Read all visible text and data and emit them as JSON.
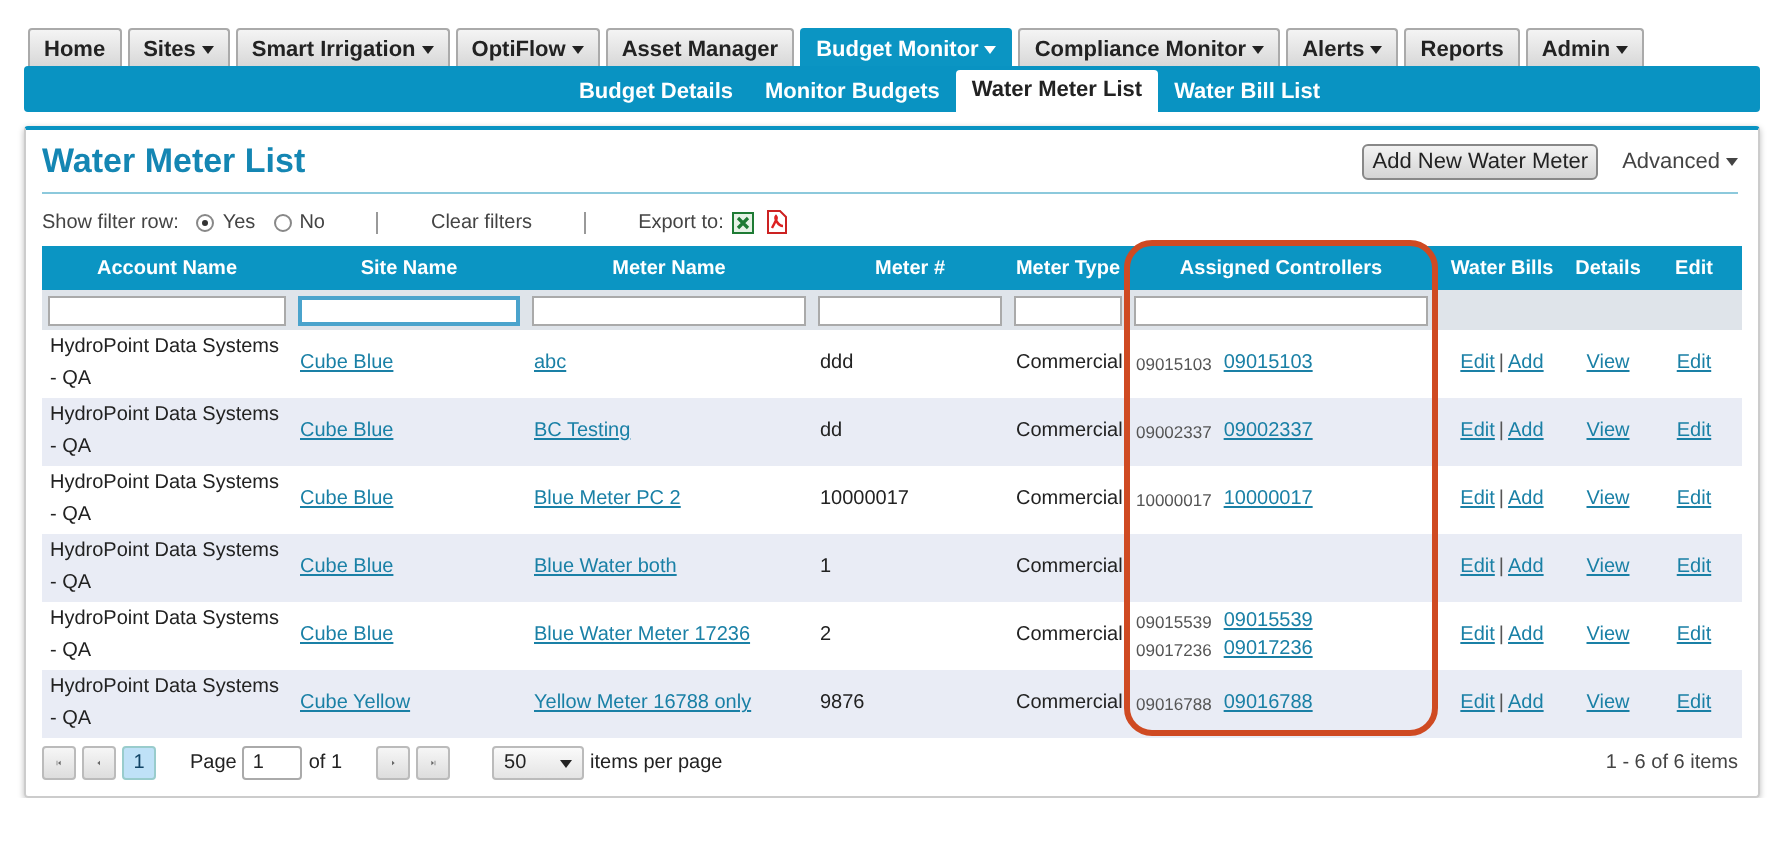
{
  "nav_tabs": [
    {
      "label": "Home",
      "dropdown": false,
      "selected": false
    },
    {
      "label": "Sites",
      "dropdown": true,
      "selected": false
    },
    {
      "label": "Smart Irrigation",
      "dropdown": true,
      "selected": false
    },
    {
      "label": "OptiFlow",
      "dropdown": true,
      "selected": false
    },
    {
      "label": "Asset Manager",
      "dropdown": false,
      "selected": false
    },
    {
      "label": "Budget Monitor",
      "dropdown": true,
      "selected": true
    },
    {
      "label": "Compliance Monitor",
      "dropdown": true,
      "selected": false
    },
    {
      "label": "Alerts",
      "dropdown": true,
      "selected": false
    },
    {
      "label": "Reports",
      "dropdown": false,
      "selected": false
    },
    {
      "label": "Admin",
      "dropdown": true,
      "selected": false
    }
  ],
  "sub_tabs": [
    {
      "label": "Budget Details",
      "selected": false
    },
    {
      "label": "Monitor Budgets",
      "selected": false
    },
    {
      "label": "Water Meter List",
      "selected": true
    },
    {
      "label": "Water Bill List",
      "selected": false
    }
  ],
  "page_title": "Water Meter List",
  "add_button": "Add New Water Meter",
  "advanced_menu": "Advanced",
  "filter_bar": {
    "label": "Show filter row:",
    "options": [
      {
        "label": "Yes",
        "selected": true
      },
      {
        "label": "No",
        "selected": false
      }
    ],
    "clear": "Clear filters",
    "export_label": "Export to:"
  },
  "table": {
    "columns": [
      {
        "label": "Account Name",
        "filter": true,
        "focused": false,
        "highlighted": false
      },
      {
        "label": "Site Name",
        "filter": true,
        "focused": true,
        "highlighted": false
      },
      {
        "label": "Meter Name",
        "filter": true,
        "focused": false,
        "highlighted": false
      },
      {
        "label": "Meter #",
        "filter": true,
        "focused": false,
        "highlighted": false
      },
      {
        "label": "Meter Type",
        "filter": true,
        "focused": false,
        "highlighted": false
      },
      {
        "label": "Assigned Controllers",
        "filter": true,
        "focused": false,
        "highlighted": true
      },
      {
        "label": "Water Bills",
        "filter": false,
        "highlighted": false
      },
      {
        "label": "Details",
        "filter": false,
        "highlighted": false
      },
      {
        "label": "Edit",
        "filter": false,
        "highlighted": false
      }
    ],
    "rows": [
      {
        "account": "HydroPoint Data Systems - QA",
        "site": "Cube Blue",
        "meter_name": "abc",
        "meter_number": "ddd",
        "meter_type": "Commercial",
        "controllers": [
          {
            "serial": "09015103",
            "link": "09015103"
          }
        ],
        "bills": [
          "Edit",
          "Add"
        ],
        "bills_separator": "|",
        "details": "View",
        "edit": "Edit"
      },
      {
        "account": "HydroPoint Data Systems - QA",
        "site": "Cube Blue",
        "meter_name": "BC Testing",
        "meter_number": "dd",
        "meter_type": "Commercial",
        "controllers": [
          {
            "serial": "09002337",
            "link": "09002337"
          }
        ],
        "bills": [
          "Edit",
          "Add"
        ],
        "bills_separator": "|",
        "details": "View",
        "edit": "Edit"
      },
      {
        "account": "HydroPoint Data Systems - QA",
        "site": "Cube Blue",
        "meter_name": "Blue Meter PC 2",
        "meter_number": "10000017",
        "meter_type": "Commercial",
        "controllers": [
          {
            "serial": "10000017",
            "link": "10000017"
          }
        ],
        "bills": [
          "Edit",
          "Add"
        ],
        "bills_separator": "|",
        "details": "View",
        "edit": "Edit"
      },
      {
        "account": "HydroPoint Data Systems - QA",
        "site": "Cube Blue",
        "meter_name": "Blue Water both",
        "meter_number": "1",
        "meter_type": "Commercial",
        "controllers": [],
        "bills": [
          "Edit",
          "Add"
        ],
        "bills_separator": "|",
        "details": "View",
        "edit": "Edit"
      },
      {
        "account": "HydroPoint Data Systems - QA",
        "site": "Cube Blue",
        "meter_name": "Blue Water Meter 17236",
        "meter_number": "2",
        "meter_type": "Commercial",
        "controllers": [
          {
            "serial": "09015539",
            "link": "09015539"
          },
          {
            "serial": "09017236",
            "link": "09017236"
          }
        ],
        "bills": [
          "Edit",
          "Add"
        ],
        "bills_separator": "|",
        "details": "View",
        "edit": "Edit"
      },
      {
        "account": "HydroPoint Data Systems - QA",
        "site": "Cube Yellow",
        "meter_name": "Yellow Meter 16788 only",
        "meter_number": "9876",
        "meter_type": "Commercial",
        "controllers": [
          {
            "serial": "09016788",
            "link": "09016788"
          }
        ],
        "bills": [
          "Edit",
          "Add"
        ],
        "bills_separator": "|",
        "details": "View",
        "edit": "Edit"
      }
    ]
  },
  "pager": {
    "pages": [
      {
        "label": "1",
        "selected": true
      }
    ],
    "page_label": "Page",
    "page_value": "1",
    "of_label": "of 1",
    "page_size": "50",
    "size_label": "items per page",
    "summary": "1 - 6 of 6 items"
  }
}
